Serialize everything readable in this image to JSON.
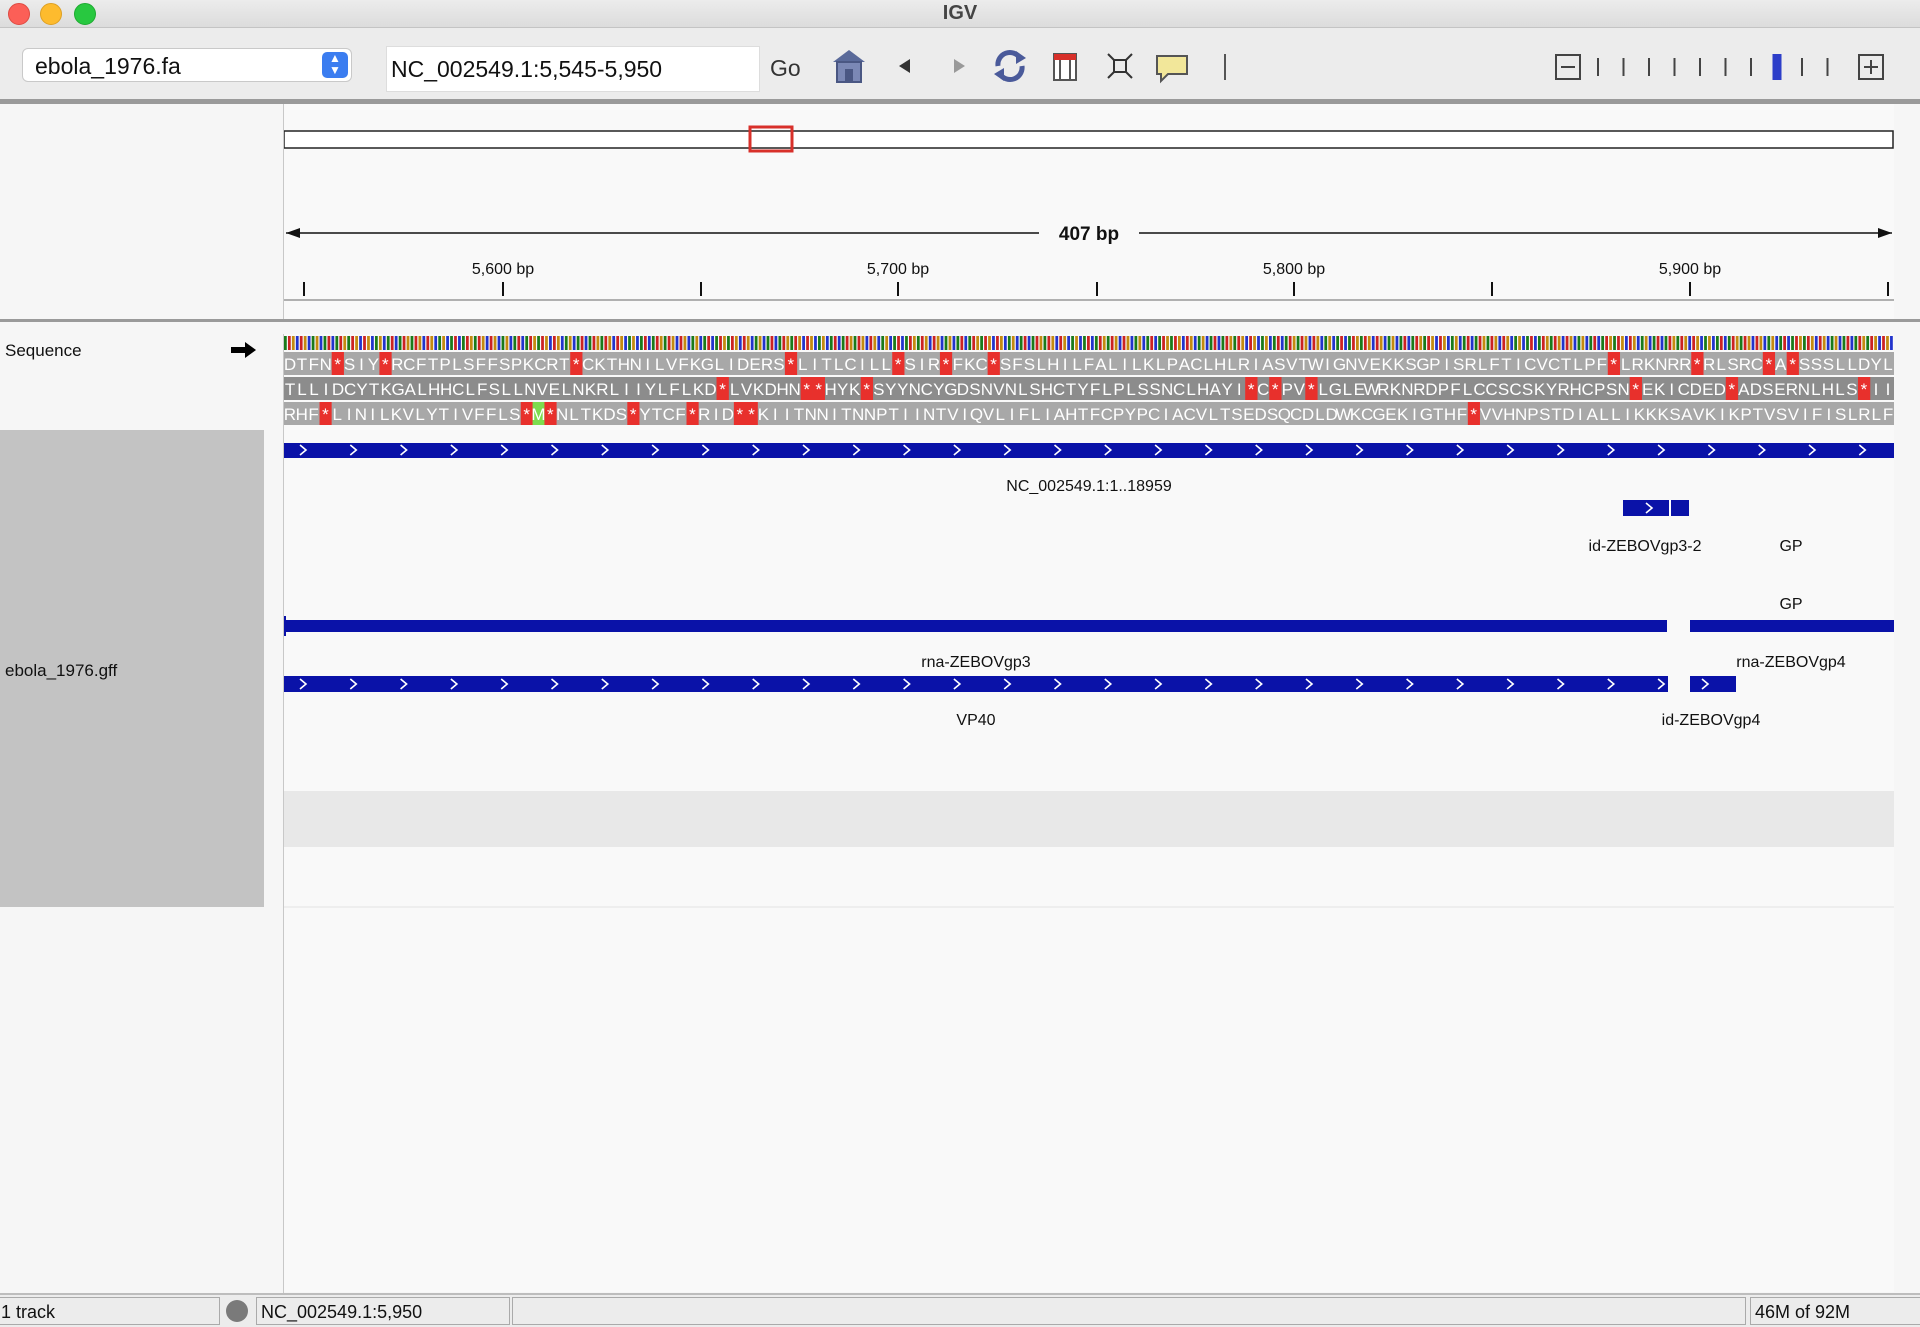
{
  "window": {
    "title": "IGV"
  },
  "toolbar": {
    "genome": "ebola_1976.fa",
    "locus": "NC_002549.1:5,545-5,950",
    "go_label": "Go",
    "zoom_level": 7,
    "zoom_levels": 10,
    "icons": [
      "home-icon",
      "back-icon",
      "forward-icon",
      "refresh-icon",
      "roi-icon",
      "resize-icon",
      "popup-info-icon"
    ]
  },
  "ruler": {
    "span_label": "407 bp",
    "ticks": [
      "5,600 bp",
      "5,700 bp",
      "5,800 bp",
      "5,900 bp"
    ]
  },
  "tracks": {
    "sequence_label": "Sequence",
    "annotation_label": "ebola_1976.gff",
    "translation": {
      "frame1": "DTFN*SIY*RCFTPLSFFSPKCRT*CKTHNILVFKGLIDERS*LITLCILL*SIR*FKC*SFSLHILFALILKLPACLHLRIASVTWIGNVEKKSGPISRLFTICVCTLPF*LRKNRR*RLSRC*A*SSSLLDYL",
      "frame2": "TLLIDCYTKGALHHCLFSLLNVELNKRLIIYLFLKD*LVKDHN**HYK*SYYNCYGDSNVNLSHCTYFLPLSSNCLHAYI*C*PV*LGLEWRKNRDPFLCCSCSKYRHCPSN*EKICDED*ADSERNLHLS*II",
      "frame3": "RHF*LINILKVLYTIVFFLS*M*NLTKDS*YTCF*RID**KIITNNITNNPTIINTVIQVLIFLIAHTFCPYPCIACVLTSEDSQCDLDWKCGEKIGTHF*VVHNPSTDIALLIKKKSAVKIKPTVSVIFISLRLF"
    },
    "features": {
      "genome_feature": "NC_002549.1:1..18959",
      "gp_exon_label": "id-ZEBOVgp3-2",
      "gp_label_1": "GP",
      "gp_label_2": "GP",
      "mrna_gp3": "rna-ZEBOVgp3",
      "mrna_gp4": "rna-ZEBOVgp4",
      "cds_vp40": "VP40",
      "cds_gp4": "id-ZEBOVgp4"
    }
  },
  "status": {
    "tracks": "1 track",
    "position": "NC_002549.1:5,950",
    "memory": "46M of 92M"
  },
  "colors": {
    "feature": "#0a12a8",
    "stop_codon": "#e8302c",
    "start_codon": "#7ddc4e",
    "roi_box": "#d8302a"
  }
}
